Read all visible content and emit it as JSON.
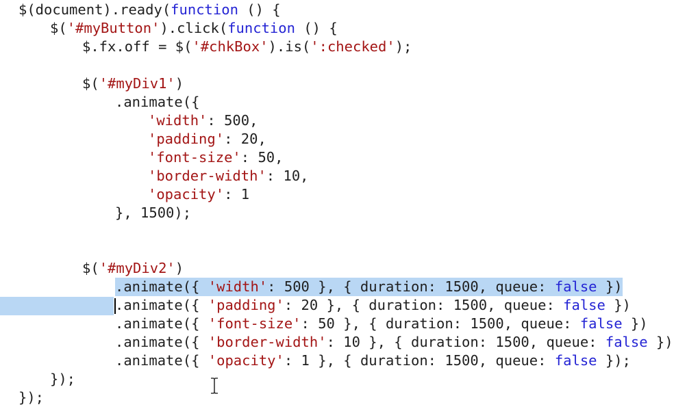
{
  "colors": {
    "keyword": "#2424d4",
    "string": "#a31515",
    "plain": "#1f1f1f",
    "selection": "#b9d7f4",
    "background": "#ffffff"
  },
  "cursor_icon": "ibeam-cursor-icon",
  "lines": [
    {
      "tokens": [
        {
          "t": "$(document).ready(",
          "c": "pl"
        },
        {
          "t": "function",
          "c": "kw"
        },
        {
          "t": " () {",
          "c": "pl"
        }
      ]
    },
    {
      "tokens": [
        {
          "t": "$(",
          "c": "pl"
        },
        {
          "t": "'#myButton'",
          "c": "str"
        },
        {
          "t": ").click(",
          "c": "pl"
        },
        {
          "t": "function",
          "c": "kw"
        },
        {
          "t": " () {",
          "c": "pl"
        }
      ]
    },
    {
      "tokens": [
        {
          "t": "$.fx.off = $(",
          "c": "pl"
        },
        {
          "t": "'#chkBox'",
          "c": "str"
        },
        {
          "t": ").is(",
          "c": "pl"
        },
        {
          "t": "':checked'",
          "c": "str"
        },
        {
          "t": ");",
          "c": "pl"
        }
      ]
    },
    {
      "tokens": []
    },
    {
      "tokens": [
        {
          "t": "$(",
          "c": "pl"
        },
        {
          "t": "'#myDiv1'",
          "c": "str"
        },
        {
          "t": ")",
          "c": "pl"
        }
      ]
    },
    {
      "tokens": [
        {
          "t": ".animate({",
          "c": "pl"
        }
      ]
    },
    {
      "tokens": [
        {
          "t": "'width'",
          "c": "str"
        },
        {
          "t": ": 500,",
          "c": "pl"
        }
      ]
    },
    {
      "tokens": [
        {
          "t": "'padding'",
          "c": "str"
        },
        {
          "t": ": 20,",
          "c": "pl"
        }
      ]
    },
    {
      "tokens": [
        {
          "t": "'font-size'",
          "c": "str"
        },
        {
          "t": ": 50,",
          "c": "pl"
        }
      ]
    },
    {
      "tokens": [
        {
          "t": "'border-width'",
          "c": "str"
        },
        {
          "t": ": 10,",
          "c": "pl"
        }
      ]
    },
    {
      "tokens": [
        {
          "t": "'opacity'",
          "c": "str"
        },
        {
          "t": ": 1",
          "c": "pl"
        }
      ]
    },
    {
      "tokens": [
        {
          "t": "}, 1500);",
          "c": "pl"
        }
      ]
    },
    {
      "tokens": []
    },
    {
      "tokens": []
    },
    {
      "tokens": [
        {
          "t": "$(",
          "c": "pl"
        },
        {
          "t": "'#myDiv2'",
          "c": "str"
        },
        {
          "t": ")",
          "c": "pl"
        }
      ]
    },
    {
      "tokens": [
        {
          "t": ".animate({ ",
          "c": "pl"
        },
        {
          "t": "'width'",
          "c": "str"
        },
        {
          "t": ": 500 }, { duration: 1500, queue: ",
          "c": "pl"
        },
        {
          "t": "false",
          "c": "kw"
        },
        {
          "t": " })",
          "c": "pl"
        }
      ]
    },
    {
      "tokens": [
        {
          "t": ".animate({ ",
          "c": "pl"
        },
        {
          "t": "'padding'",
          "c": "str"
        },
        {
          "t": ": 20 }, { duration: 1500, queue: ",
          "c": "pl"
        },
        {
          "t": "false",
          "c": "kw"
        },
        {
          "t": " })",
          "c": "pl"
        }
      ]
    },
    {
      "tokens": [
        {
          "t": ".animate({ ",
          "c": "pl"
        },
        {
          "t": "'font-size'",
          "c": "str"
        },
        {
          "t": ": 50 }, { duration: 1500, queue: ",
          "c": "pl"
        },
        {
          "t": "false",
          "c": "kw"
        },
        {
          "t": " })",
          "c": "pl"
        }
      ]
    },
    {
      "tokens": [
        {
          "t": ".animate({ ",
          "c": "pl"
        },
        {
          "t": "'border-width'",
          "c": "str"
        },
        {
          "t": ": 10 }, { duration: 1500, queue: ",
          "c": "pl"
        },
        {
          "t": "false",
          "c": "kw"
        },
        {
          "t": " })",
          "c": "pl"
        }
      ]
    },
    {
      "tokens": [
        {
          "t": ".animate({ ",
          "c": "pl"
        },
        {
          "t": "'opacity'",
          "c": "str"
        },
        {
          "t": ": 1 }, { duration: 1500, queue: ",
          "c": "pl"
        },
        {
          "t": "false",
          "c": "kw"
        },
        {
          "t": " });",
          "c": "pl"
        }
      ]
    },
    {
      "tokens": [
        {
          "t": "});",
          "c": "pl"
        }
      ]
    },
    {
      "tokens": [
        {
          "t": "});",
          "c": "pl"
        }
      ]
    }
  ]
}
